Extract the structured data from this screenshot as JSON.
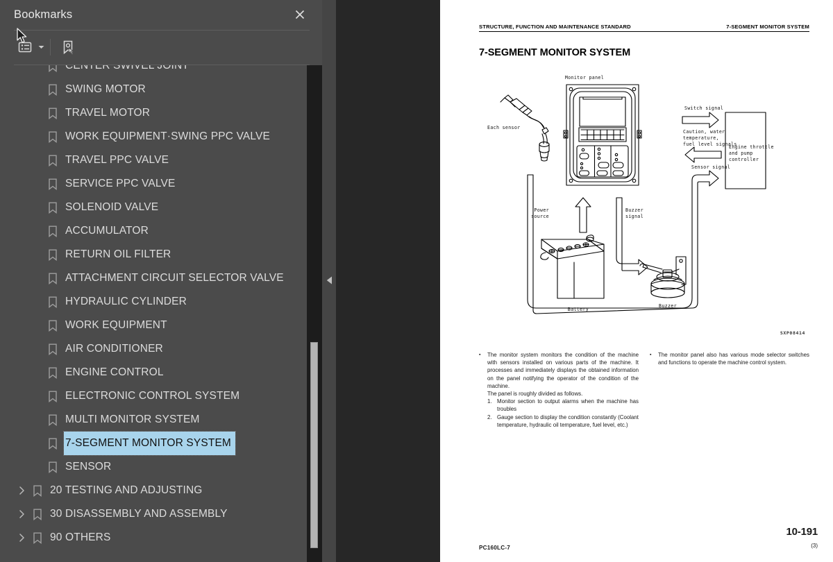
{
  "sidebar": {
    "title": "Bookmarks",
    "close_icon": "close-icon",
    "toolbar": {
      "list_options_label": "list-options-icon",
      "caret_label": "chevron-down-icon",
      "new_bookmark_label": "new-bookmark-icon"
    },
    "items": [
      {
        "label": "CENTER SWIVEL JOINT",
        "level": 1,
        "expandable": false,
        "selected": false,
        "clipped_top": true
      },
      {
        "label": "SWING MOTOR",
        "level": 1,
        "expandable": false,
        "selected": false
      },
      {
        "label": "TRAVEL MOTOR",
        "level": 1,
        "expandable": false,
        "selected": false
      },
      {
        "label": "WORK EQUIPMENT·SWING PPC VALVE",
        "level": 1,
        "expandable": false,
        "selected": false
      },
      {
        "label": "TRAVEL PPC VALVE",
        "level": 1,
        "expandable": false,
        "selected": false
      },
      {
        "label": "SERVICE PPC VALVE",
        "level": 1,
        "expandable": false,
        "selected": false
      },
      {
        "label": "SOLENOID VALVE",
        "level": 1,
        "expandable": false,
        "selected": false
      },
      {
        "label": "ACCUMULATOR",
        "level": 1,
        "expandable": false,
        "selected": false
      },
      {
        "label": "RETURN OIL FILTER",
        "level": 1,
        "expandable": false,
        "selected": false
      },
      {
        "label": "ATTACHMENT CIRCUIT SELECTOR VALVE",
        "level": 1,
        "expandable": false,
        "selected": false
      },
      {
        "label": "HYDRAULIC CYLINDER",
        "level": 1,
        "expandable": false,
        "selected": false
      },
      {
        "label": "WORK EQUIPMENT",
        "level": 1,
        "expandable": false,
        "selected": false
      },
      {
        "label": "AIR CONDITIONER",
        "level": 1,
        "expandable": false,
        "selected": false
      },
      {
        "label": "ENGINE CONTROL",
        "level": 1,
        "expandable": false,
        "selected": false
      },
      {
        "label": "ELECTRONIC CONTROL SYSTEM",
        "level": 1,
        "expandable": false,
        "selected": false
      },
      {
        "label": "MULTI MONITOR SYSTEM",
        "level": 1,
        "expandable": false,
        "selected": false
      },
      {
        "label": "7-SEGMENT MONITOR SYSTEM",
        "level": 1,
        "expandable": false,
        "selected": true
      },
      {
        "label": "SENSOR",
        "level": 1,
        "expandable": false,
        "selected": false
      },
      {
        "label": "20 TESTING AND ADJUSTING",
        "level": 0,
        "expandable": true,
        "selected": false
      },
      {
        "label": "30 DISASSEMBLY AND ASSEMBLY",
        "level": 0,
        "expandable": true,
        "selected": false
      },
      {
        "label": "90 OTHERS",
        "level": 0,
        "expandable": true,
        "selected": false
      }
    ],
    "selection_color": "#a8d4ec",
    "panel_color": "#4b4b4b"
  },
  "viewer": {
    "collapse_icon": "triangle-left-icon"
  },
  "document": {
    "header_left": "STRUCTURE, FUNCTION AND MAINTENANCE STANDARD",
    "header_right": "7-SEGMENT MONITOR SYSTEM",
    "title": "7-SEGMENT MONITOR SYSTEM",
    "figure": {
      "code": "SXP08414",
      "labels": {
        "monitor_panel": "Monitor panel",
        "each_sensor": "Each sensor",
        "switch_signal": "Switch signal",
        "caution_signals_l1": "Caution, water",
        "caution_signals_l2": "temperature,",
        "caution_signals_l3": "fuel level signals",
        "sensor_signal": "Sensor signal",
        "controller_l1": "Engine throttle",
        "controller_l2": "and pump",
        "controller_l3": "controller",
        "power_source_l1": "Power",
        "power_source_l2": "source",
        "buzzer_signal_l1": "Buzzer",
        "buzzer_signal_l2": "signal",
        "buzzer": "Buzzer",
        "battery": "Battery"
      }
    },
    "body": {
      "left_bullet": "The monitor system monitors the condition of the machine with sensors installed on various parts of the machine. It processes and immediately displays the obtained information on the panel notifying the operator of the condition of the machine.",
      "left_followup": "The panel is roughly divided as follows.",
      "left_numbered": [
        {
          "num": "1.",
          "text": "Monitor section to output alarms when the machine has troubles"
        },
        {
          "num": "2.",
          "text": "Gauge section to display the condition constantly (Coolant temperature, hydraulic oil temperature, fuel level, etc.)"
        }
      ],
      "right_bullet": "The monitor panel also has various mode selector switches and functions to operate the machine control system."
    },
    "footer": {
      "model": "PC160LC-7",
      "page_number": "10-191",
      "page_revision": "(3)"
    }
  }
}
